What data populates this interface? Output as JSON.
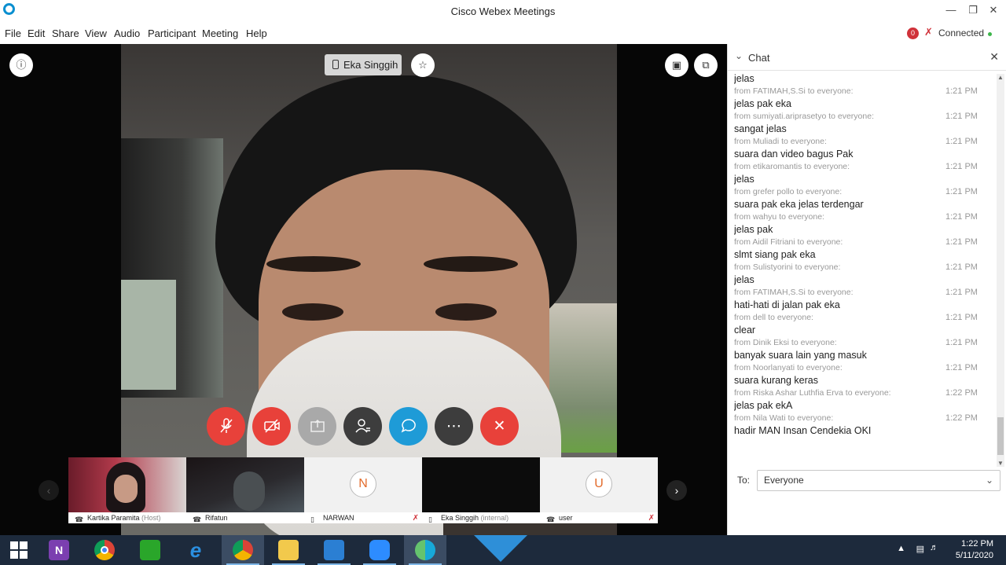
{
  "window": {
    "title": "Cisco Webex Meetings"
  },
  "menu": [
    "File",
    "Edit",
    "Share",
    "View",
    "Audio",
    "Participant",
    "Meeting",
    "Help"
  ],
  "status": {
    "badge": "0",
    "connection": "Connected"
  },
  "active_speaker": "Eka Singgih",
  "controls": [
    "mute-mic",
    "stop-video",
    "share",
    "participants",
    "chat",
    "more",
    "leave"
  ],
  "participants": [
    {
      "name": "Kartika Paramita",
      "role": "(Host)",
      "type": "video"
    },
    {
      "name": "Rifatun",
      "role": "",
      "type": "video"
    },
    {
      "name": "NARWAN",
      "role": "",
      "type": "avatar",
      "initial": "N"
    },
    {
      "name": "Eka Singgih",
      "role": "(internal)",
      "type": "video-hidden"
    },
    {
      "name": "user",
      "role": "",
      "type": "avatar",
      "initial": "U"
    }
  ],
  "chat": {
    "title": "Chat",
    "messages": [
      {
        "text": "jelas",
        "from": "from FATIMAH,S.Si to everyone:",
        "time": "1:21 PM"
      },
      {
        "text": "jelas pak eka",
        "from": "from sumiyati.ariprasetyo to everyone:",
        "time": "1:21 PM"
      },
      {
        "text": "sangat jelas",
        "from": "from Muliadi to everyone:",
        "time": "1:21 PM"
      },
      {
        "text": "suara dan video bagus Pak",
        "from": "from etikaromantis to everyone:",
        "time": "1:21 PM"
      },
      {
        "text": "jelas",
        "from": "from grefer pollo to everyone:",
        "time": "1:21 PM"
      },
      {
        "text": "suara pak eka jelas terdengar",
        "from": "from wahyu to everyone:",
        "time": "1:21 PM"
      },
      {
        "text": "jelas pak",
        "from": "from Aidil Fitriani to everyone:",
        "time": "1:21 PM"
      },
      {
        "text": "slmt siang pak eka",
        "from": "from Sulistyorini to everyone:",
        "time": "1:21 PM"
      },
      {
        "text": "jelas",
        "from": "from FATIMAH,S.Si to everyone:",
        "time": "1:21 PM"
      },
      {
        "text": "hati-hati di jalan pak eka",
        "from": "from dell to everyone:",
        "time": "1:21 PM"
      },
      {
        "text": "clear",
        "from": "from Dinik Eksi to everyone:",
        "time": "1:21 PM"
      },
      {
        "text": "banyak suara lain yang masuk",
        "from": "from Noorlanyati to everyone:",
        "time": "1:21 PM"
      },
      {
        "text": "suara kurang keras",
        "from": "from Riska Ashar Luthfia Erva to everyone:",
        "time": "1:22 PM"
      },
      {
        "text": "jelas pak ekA",
        "from": "from Nila Wati to everyone:",
        "time": "1:22 PM"
      },
      {
        "text": "hadir MAN Insan Cendekia OKI",
        "from": "",
        "time": ""
      }
    ],
    "to_label": "To:",
    "to_value": "Everyone"
  },
  "taskbar": {
    "apps": [
      "start",
      "onenote",
      "chrome",
      "store",
      "internet-explorer",
      "chrome-user",
      "file-explorer",
      "onedrive",
      "zoom",
      "webex"
    ],
    "time": "1:22 PM",
    "date": "5/11/2020"
  }
}
